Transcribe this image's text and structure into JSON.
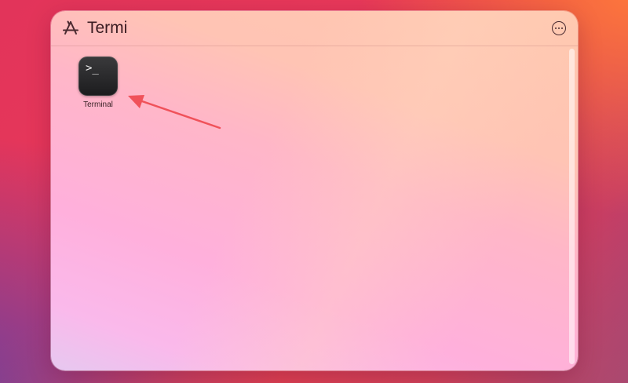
{
  "search": {
    "query": "Termi"
  },
  "results": [
    {
      "label": "Terminal",
      "icon": "terminal-icon",
      "icon_text": ">_"
    }
  ],
  "colors": {
    "arrow": "#f0525a",
    "terminal_bg": "#1c1c1e"
  }
}
